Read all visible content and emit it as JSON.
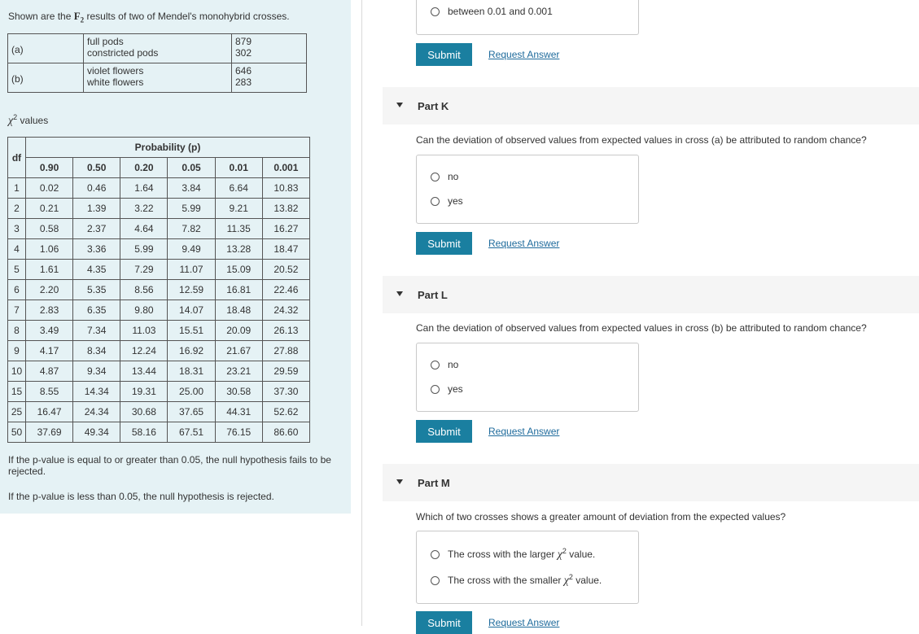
{
  "intro": {
    "prefix": "Shown are the ",
    "gen": "F",
    "gen_sub": "2",
    "suffix": " results of two of Mendel's monohybrid crosses."
  },
  "crosses": [
    {
      "label": "(a)",
      "phenotypes": [
        "full pods",
        "constricted pods"
      ],
      "counts": [
        "879",
        "302"
      ]
    },
    {
      "label": "(b)",
      "phenotypes": [
        "violet flowers",
        "white flowers"
      ],
      "counts": [
        "646",
        "283"
      ]
    }
  ],
  "chi": {
    "symbol": "χ",
    "sup": "2",
    "label": " values",
    "df_header": "df",
    "prob_header": "Probability (p)",
    "p_values": [
      "0.90",
      "0.50",
      "0.20",
      "0.05",
      "0.01",
      "0.001"
    ],
    "rows": [
      [
        "1",
        "0.02",
        "0.46",
        "1.64",
        "3.84",
        "6.64",
        "10.83"
      ],
      [
        "2",
        "0.21",
        "1.39",
        "3.22",
        "5.99",
        "9.21",
        "13.82"
      ],
      [
        "3",
        "0.58",
        "2.37",
        "4.64",
        "7.82",
        "11.35",
        "16.27"
      ],
      [
        "4",
        "1.06",
        "3.36",
        "5.99",
        "9.49",
        "13.28",
        "18.47"
      ],
      [
        "5",
        "1.61",
        "4.35",
        "7.29",
        "11.07",
        "15.09",
        "20.52"
      ],
      [
        "6",
        "2.20",
        "5.35",
        "8.56",
        "12.59",
        "16.81",
        "22.46"
      ],
      [
        "7",
        "2.83",
        "6.35",
        "9.80",
        "14.07",
        "18.48",
        "24.32"
      ],
      [
        "8",
        "3.49",
        "7.34",
        "11.03",
        "15.51",
        "20.09",
        "26.13"
      ],
      [
        "9",
        "4.17",
        "8.34",
        "12.24",
        "16.92",
        "21.67",
        "27.88"
      ],
      [
        "10",
        "4.87",
        "9.34",
        "13.44",
        "18.31",
        "23.21",
        "29.59"
      ],
      [
        "15",
        "8.55",
        "14.34",
        "19.31",
        "25.00",
        "30.58",
        "37.30"
      ],
      [
        "25",
        "16.47",
        "24.34",
        "30.68",
        "37.65",
        "44.31",
        "52.62"
      ],
      [
        "50",
        "37.69",
        "49.34",
        "58.16",
        "67.51",
        "76.15",
        "86.60"
      ]
    ]
  },
  "notes": {
    "fail": "If the p-value is equal to or greater than 0.05, the null hypothesis fails to be rejected.",
    "reject": "If the p-value is less than 0.05, the null hypothesis is rejected."
  },
  "part_j": {
    "last_option": "between 0.01 and 0.001",
    "submit": "Submit",
    "request": "Request Answer"
  },
  "part_k": {
    "title": "Part K",
    "question": "Can the deviation of observed values from expected values in cross (a) be attributed to random chance?",
    "options": [
      "no",
      "yes"
    ],
    "submit": "Submit",
    "request": "Request Answer"
  },
  "part_l": {
    "title": "Part L",
    "question": "Can the deviation of observed values from expected values in cross (b) be attributed to random chance?",
    "options": [
      "no",
      "yes"
    ],
    "submit": "Submit",
    "request": "Request Answer"
  },
  "part_m": {
    "title": "Part M",
    "question": "Which of two crosses shows a greater amount of deviation from the expected values?",
    "options": [
      {
        "before": "The cross with the larger ",
        "symbol": "χ",
        "sup": "2",
        "after": " value."
      },
      {
        "before": "The cross with the smaller ",
        "symbol": "χ",
        "sup": "2",
        "after": " value."
      }
    ],
    "submit": "Submit",
    "request": "Request Answer"
  }
}
